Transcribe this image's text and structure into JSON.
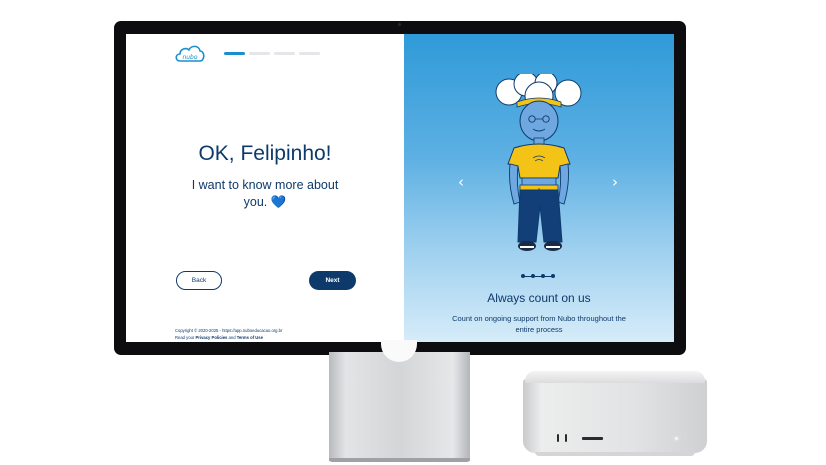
{
  "brand": {
    "logo_text": "nubo",
    "color": "#1a8fd0"
  },
  "colors": {
    "navy": "#0e3a6b",
    "accent": "#1a8fd0",
    "panel_top": "#2f9ad8",
    "panel_bottom": "#d6ecf9"
  },
  "progress": {
    "steps_total": 4,
    "current_step": 1
  },
  "main": {
    "greeting": "OK, Felipinho!",
    "subtitle": "I want to know more about you.",
    "subtitle_emoji": "💙"
  },
  "buttons": {
    "back_label": "Back",
    "next_label": "Next"
  },
  "footer": {
    "copyright": "Copyright © 2020-2025 - https://app.nuboeducacao.org.br",
    "read_prefix": "Read your ",
    "privacy_link": "Privacy Policies",
    "and": " and ",
    "terms_link": "Terms of Use"
  },
  "carousel": {
    "prev_icon": "chevron-left-icon",
    "next_icon": "chevron-right-icon",
    "slide_count": 4,
    "active_slide": 1,
    "title": "Always count on us",
    "text": "Count on ongoing support from Nubo throughout the entire process"
  },
  "hardware": {
    "monitor": "studio-display",
    "computer": "mac-studio"
  }
}
